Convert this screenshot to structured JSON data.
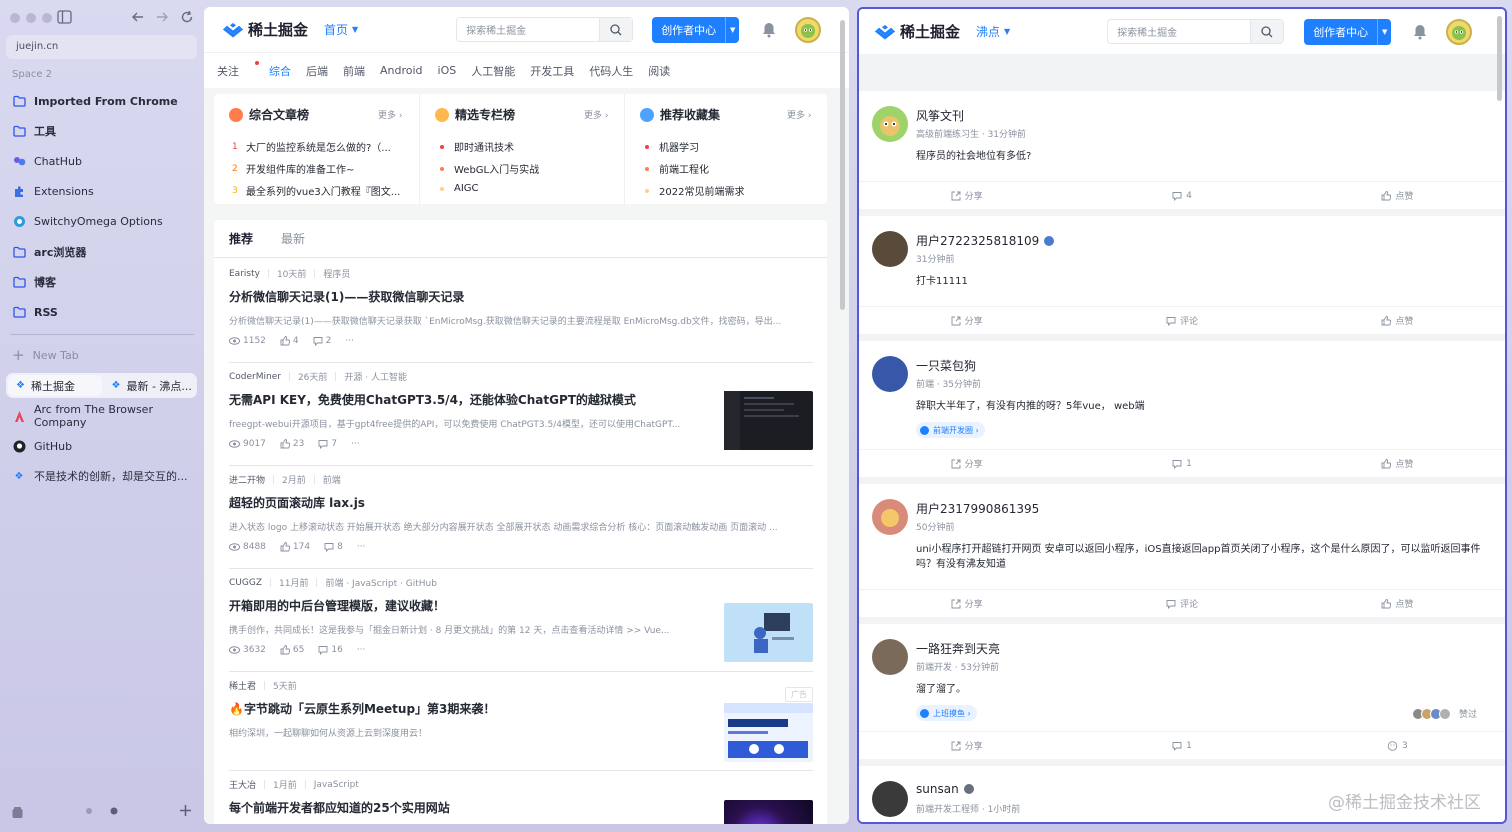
{
  "browser": {
    "url": "juejin.cn",
    "space": "Space 2",
    "new_tab": "New Tab"
  },
  "sidebar": {
    "items": [
      {
        "label": "Imported From Chrome",
        "icon": "folder-icon"
      },
      {
        "label": "工具",
        "icon": "folder-icon"
      },
      {
        "label": "ChatHub",
        "icon": "chathub-icon"
      },
      {
        "label": "Extensions",
        "icon": "puzzle-icon"
      },
      {
        "label": "SwitchyOmega Options",
        "icon": "switchy-icon"
      },
      {
        "label": "arc浏览器",
        "icon": "folder-icon"
      },
      {
        "label": "博客",
        "icon": "folder-icon"
      },
      {
        "label": "RSS",
        "icon": "folder-icon"
      }
    ],
    "split_tabs": [
      "稀土掘金",
      "最新 - 沸点..."
    ],
    "tabs": [
      {
        "label": "Arc from The Browser Company"
      },
      {
        "label": "GitHub"
      },
      {
        "label": "不是技术的创新，却是交互的..."
      }
    ]
  },
  "left": {
    "logo": "稀土掘金",
    "nav": "首页",
    "search_placeholder": "探索稀土掘金",
    "creator": "创作者中心",
    "categories": [
      "关注",
      "综合",
      "后端",
      "前端",
      "Android",
      "iOS",
      "人工智能",
      "开发工具",
      "代码人生",
      "阅读"
    ],
    "rank": [
      {
        "title": "综合文章榜",
        "more": "更多",
        "items": [
          "大厂的监控系统是怎么做的?（...",
          "开发组件库的准备工作~",
          "最全系列的vue3入门教程『图文..."
        ]
      },
      {
        "title": "精选专栏榜",
        "more": "更多",
        "items": [
          "即时通讯技术",
          "WebGL入门与实战",
          "AIGC"
        ]
      },
      {
        "title": "推荐收藏集",
        "more": "更多",
        "items": [
          "机器学习",
          "前端工程化",
          "2022常见前端需求"
        ]
      }
    ],
    "feed_tabs": [
      "推荐",
      "最新"
    ],
    "articles": [
      {
        "author": "Earisty",
        "time": "10天前",
        "tags": "程序员",
        "title": "分析微信聊天记录(1)——获取微信聊天记录",
        "brief": "分析微信聊天记录(1)——获取微信聊天记录获取 `EnMicroMsg.获取微信聊天记录的主要流程是取 EnMicroMsg.db文件，找密码，导出...",
        "views": "1152",
        "likes": "4",
        "comments": "2"
      },
      {
        "author": "CoderMiner",
        "time": "26天前",
        "tags": "开源 · 人工智能",
        "title": "无需API KEY，免费使用ChatGPT3.5/4，还能体验ChatGPT的越狱模式",
        "brief": "freegpt-webui开源项目，基于gpt4free提供的API，可以免费使用 ChatPGT3.5/4模型，还可以使用ChatGPT...",
        "views": "9017",
        "likes": "23",
        "comments": "7"
      },
      {
        "author": "进二开物",
        "time": "2月前",
        "tags": "前端",
        "title": "超轻的页面滚动库 lax.js",
        "brief": "进入状态 logo 上移滚动状态 开始展开状态 绝大部分内容展开状态 全部展开状态 动画需求综合分析 核心：页面滚动触发动画 页面滚动 ...",
        "views": "8488",
        "likes": "174",
        "comments": "8"
      },
      {
        "author": "CUGGZ",
        "time": "11月前",
        "tags": "前端 · JavaScript · GitHub",
        "title": "开箱即用的中后台管理模版，建议收藏！",
        "brief": "携手创作，共同成长！这是我参与「掘金日新计划 · 8 月更文挑战」的第 12 天，点击查看活动详情 >> Vue...",
        "views": "3632",
        "likes": "65",
        "comments": "16"
      },
      {
        "author": "稀土君",
        "time": "5天前",
        "tags": "",
        "title": "🔥字节跳动「云原生系列Meetup」第3期来袭！",
        "brief": "相约深圳，一起聊聊如何从资源上云到深度用云！",
        "ad": "广告"
      },
      {
        "author": "王大冶",
        "time": "1月前",
        "tags": "JavaScript",
        "title": "每个前端开发者都应知道的25个实用网站"
      }
    ]
  },
  "right": {
    "logo": "稀土掘金",
    "nav": "沸点",
    "search_placeholder": "探索稀土掘金",
    "creator": "创作者中心",
    "pins": [
      {
        "name": "风筝文刊",
        "meta": "高级前端练习生 · 31分钟前",
        "text": "程序员的社会地位有多低?",
        "share": "分享",
        "comment": "4",
        "like": "点赞"
      },
      {
        "name": "用户2722325818109",
        "meta": "31分钟前",
        "text": "打卡11111",
        "share": "分享",
        "comment": "评论",
        "like": "点赞"
      },
      {
        "name": "一只菜包狗",
        "meta": "前端 · 35分钟前",
        "text": "辞职大半年了，有没有内推的呀？5年vue， web端",
        "tag": "前端开发圈 ›",
        "share": "分享",
        "comment": "1",
        "like": "点赞"
      },
      {
        "name": "用户2317990861395",
        "meta": "50分钟前",
        "text": "uni小程序打开超链打开网页 安卓可以返回小程序，iOS直接返回app首页关闭了小程序，这个是什么原因了，可以监听返回事件吗？有没有沸友知道",
        "share": "分享",
        "comment": "评论",
        "like": "点赞"
      },
      {
        "name": "一路狂奔到天亮",
        "meta": "前端开发 · 53分钟前",
        "text": "溜了溜了。",
        "tag": "上班摸鱼 ›",
        "liked": "赞过",
        "share": "分享",
        "comment": "1",
        "like": "3"
      },
      {
        "name": "sunsan",
        "meta": "前端开发工程师 · 1小时前"
      }
    ]
  },
  "watermark": "@稀土掘金技术社区",
  "colors": {
    "brand": "#1e80ff",
    "accent_border": "#5457d8"
  }
}
